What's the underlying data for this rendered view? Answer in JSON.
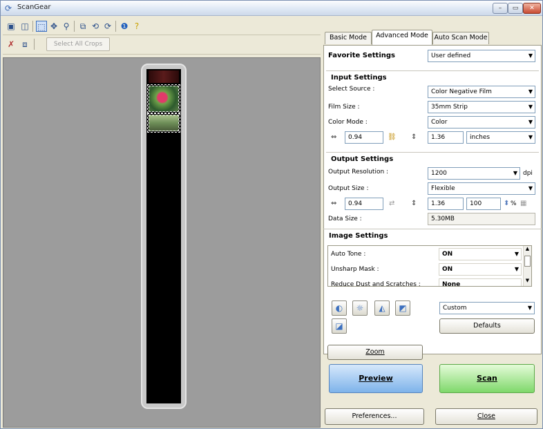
{
  "window": {
    "title": "ScanGear",
    "min": "–",
    "max": "▭",
    "close": "✕"
  },
  "toolbar": {
    "select_all_crops": "Select All Crops"
  },
  "tabs": [
    "Basic Mode",
    "Advanced Mode",
    "Auto Scan Mode"
  ],
  "favorite": {
    "label": "Favorite Settings",
    "value": "User defined"
  },
  "input": {
    "heading": "Input Settings",
    "select_source_label": "Select Source :",
    "select_source": "Color Negative Film",
    "film_size_label": "Film Size :",
    "film_size": "35mm Strip",
    "color_mode_label": "Color Mode :",
    "color_mode": "Color",
    "width": "0.94",
    "height": "1.36",
    "unit": "inches"
  },
  "output": {
    "heading": "Output Settings",
    "resolution_label": "Output Resolution :",
    "resolution": "1200",
    "dpi": "dpi",
    "size_label": "Output Size :",
    "size": "Flexible",
    "width": "0.94",
    "height": "1.36",
    "scale": "100",
    "pct": "%",
    "data_size_label": "Data Size :",
    "data_size": "5.30MB"
  },
  "image": {
    "heading": "Image Settings",
    "auto_tone_label": "Auto Tone :",
    "auto_tone": "ON",
    "unsharp_label": "Unsharp Mask :",
    "unsharp": "ON",
    "partial_label": "Reduce Dust and Scratches :",
    "partial": "None"
  },
  "adjust": {
    "preset": "Custom",
    "defaults": "Defaults"
  },
  "buttons": {
    "zoom": "Zoom",
    "preview": "Preview",
    "scan": "Scan",
    "preferences": "Preferences...",
    "close": "Close"
  }
}
